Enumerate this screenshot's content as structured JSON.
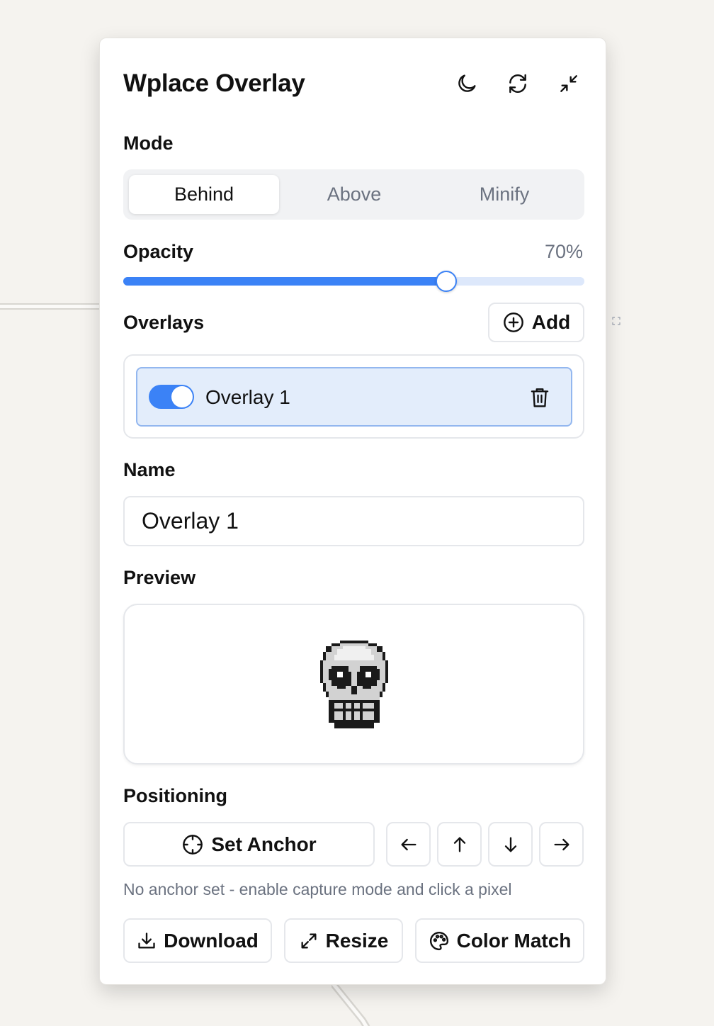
{
  "panel": {
    "title": "Wplace Overlay",
    "header_icons": [
      "moon-icon",
      "refresh-icon",
      "minimize-icon"
    ]
  },
  "mode": {
    "label": "Mode",
    "options": [
      "Behind",
      "Above",
      "Minify"
    ],
    "selected": "Behind"
  },
  "opacity": {
    "label": "Opacity",
    "value_text": "70%",
    "value": 0.7
  },
  "overlays": {
    "label": "Overlays",
    "add_label": "Add",
    "items": [
      {
        "name": "Overlay 1",
        "enabled": true,
        "selected": true
      }
    ]
  },
  "name_field": {
    "label": "Name",
    "value": "Overlay 1"
  },
  "preview": {
    "label": "Preview",
    "image": "skull-pixel-art"
  },
  "positioning": {
    "label": "Positioning",
    "set_anchor_label": "Set Anchor",
    "arrows": [
      "arrow-left-icon",
      "arrow-up-icon",
      "arrow-down-icon",
      "arrow-right-icon"
    ],
    "hint": "No anchor set - enable capture mode and click a pixel"
  },
  "actions": {
    "download_label": "Download",
    "resize_label": "Resize",
    "color_match_label": "Color Match"
  },
  "colors": {
    "accent": "#3b82f6",
    "accent_light": "#e3edfb",
    "muted_text": "#6b7280",
    "background": "#f5f3ef"
  }
}
